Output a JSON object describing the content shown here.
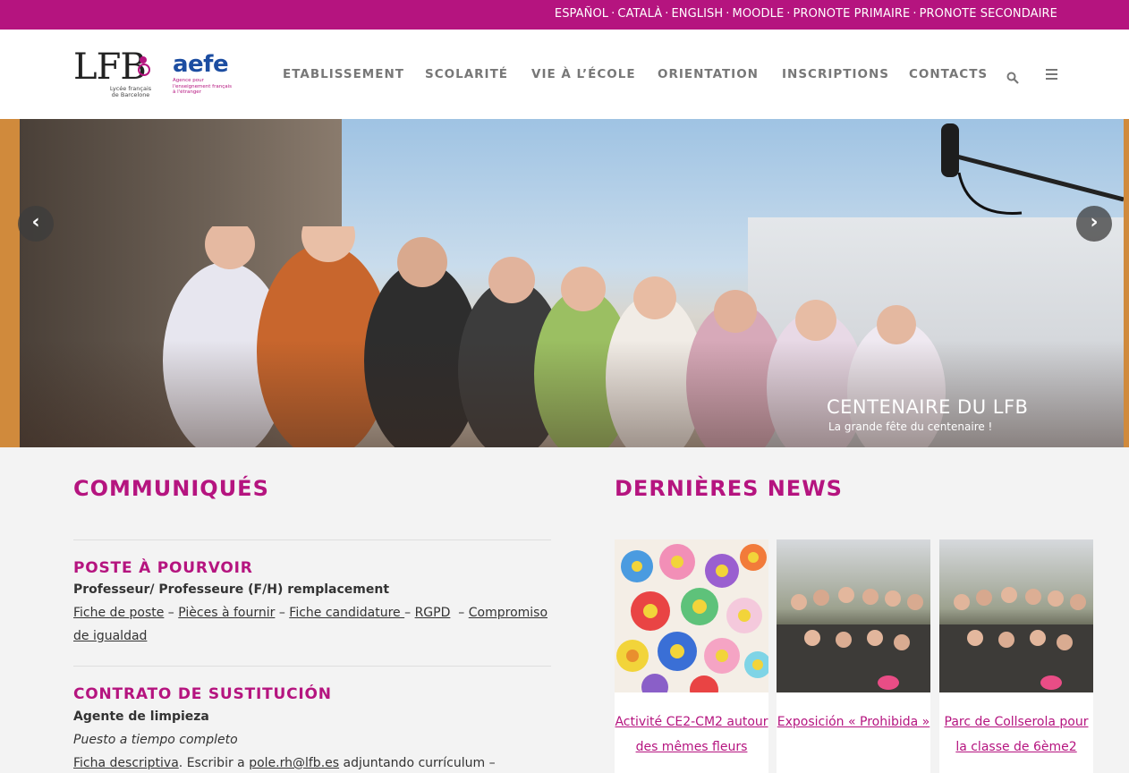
{
  "topbar": {
    "links": [
      "ESPAÑOL",
      "CATALÀ",
      "ENGLISH",
      "MOODLE",
      "PRONOTE PRIMAIRE",
      "PRONOTE SECONDAIRE"
    ],
    "separator": "·"
  },
  "logo": {
    "lfb_text": "LFB",
    "lfb_subtitle_1": "Lycée français",
    "lfb_subtitle_2": "de Barcelone",
    "aefe_word": "aefe",
    "aefe_tag_1": "Agence pour",
    "aefe_tag_2": "l'enseignement français",
    "aefe_tag_3": "à l'étranger"
  },
  "nav": {
    "items": [
      "ETABLISSEMENT",
      "SCOLARITÉ",
      "VIE À L’ÉCOLE",
      "ORIENTATION",
      "INSCRIPTIONS",
      "CONTACTS"
    ]
  },
  "hero": {
    "title": "CENTENAIRE DU LFB",
    "subtitle": "La grande fête du centenaire !"
  },
  "communiques": {
    "heading": "COMMUNIQUÉS",
    "poste": {
      "title": "POSTE À POURVOIR",
      "subtitle": "Professeur/ Professeure (F/H) remplacement",
      "links": [
        "Fiche de poste",
        "Pièces à fournir",
        "Fiche candidature ",
        "RGPD",
        "Compromiso de igualdad"
      ]
    },
    "contrato": {
      "title": "CONTRATO DE SUSTITUCIÓN",
      "subtitle": "Agente de limpieza",
      "detail": "Puesto a tiempo completo",
      "link_ficha": "Ficha descriptiva",
      "text_escribir": ". Escribir a ",
      "email": "pole.rh@lfb.es",
      "text_after": " adjuntando currículum –"
    }
  },
  "news": {
    "heading": "DERNIÈRES NEWS",
    "items": [
      {
        "title": "Activité CE2-CM2 autour des mêmes fleurs"
      },
      {
        "title": "Exposición « Prohibida »"
      },
      {
        "title": "Parc de Collserola pour la classe de 6ème2"
      }
    ]
  },
  "colors": {
    "brand": "#b5147f",
    "aefe_blue": "#1c4da1"
  }
}
